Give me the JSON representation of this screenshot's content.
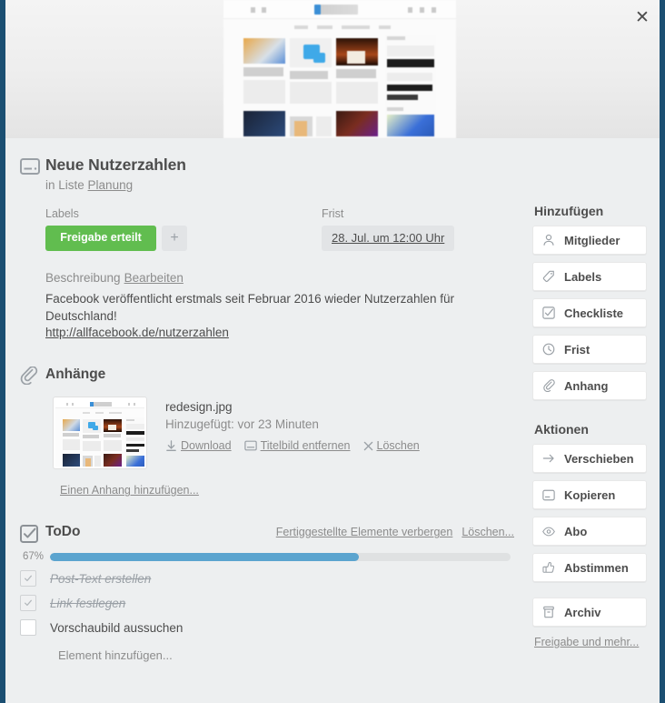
{
  "window": {
    "close_label": "✕"
  },
  "card": {
    "icon": "card-icon",
    "title": "Neue Nutzerzahlen",
    "in_list_prefix": "in Liste",
    "list_name": "Planung"
  },
  "labels": {
    "heading": "Labels",
    "badge": "Freigabe erteilt",
    "badge_color": "#61bd4f",
    "add_label": "+"
  },
  "due": {
    "heading": "Frist",
    "value": "28. Jul. um 12:00 Uhr"
  },
  "description": {
    "heading": "Beschreibung",
    "edit_label": "Bearbeiten",
    "body": "Facebook veröffentlicht erstmals seit Februar 2016 wieder Nutzerzahlen für Deutschland!",
    "link": "http://allfacebook.de/nutzerzahlen"
  },
  "attachments": {
    "heading": "Anhänge",
    "items": [
      {
        "filename": "redesign.jpg",
        "added": "Hinzugefügt: vor 23 Minuten",
        "actions": [
          {
            "icon": "download-icon",
            "label": "Download"
          },
          {
            "icon": "cover-image-icon",
            "label": "Titelbild entfernen"
          },
          {
            "icon": "close-icon",
            "label": "Löschen"
          }
        ]
      }
    ],
    "add_link": "Einen Anhang hinzufügen..."
  },
  "checklist": {
    "heading": "ToDo",
    "hide_completed_label": "Fertiggestellte Elemente verbergen",
    "delete_label": "Löschen...",
    "progress_pct_text": "67%",
    "progress_pct": 67,
    "progress_color": "#5ba4cf",
    "items": [
      {
        "text": "Post-Text erstellen",
        "checked": true
      },
      {
        "text": "Link festlegen",
        "checked": true
      },
      {
        "text": "Vorschaubild aussuchen",
        "checked": false
      }
    ],
    "add_item_label": "Element hinzufügen..."
  },
  "sidebar": {
    "add_heading": "Hinzufügen",
    "add_items": [
      {
        "icon": "member-icon",
        "label": "Mitglieder"
      },
      {
        "icon": "label-icon",
        "label": "Labels"
      },
      {
        "icon": "checklist-icon",
        "label": "Checkliste"
      },
      {
        "icon": "clock-icon",
        "label": "Frist"
      },
      {
        "icon": "attachment-icon",
        "label": "Anhang"
      }
    ],
    "actions_heading": "Aktionen",
    "action_items": [
      {
        "icon": "arrow-right-icon",
        "label": "Verschieben"
      },
      {
        "icon": "card-icon",
        "label": "Kopieren"
      },
      {
        "icon": "eye-icon",
        "label": "Abo"
      },
      {
        "icon": "thumbs-up-icon",
        "label": "Abstimmen"
      }
    ],
    "archive_item": {
      "icon": "archive-icon",
      "label": "Archiv"
    },
    "more_link": "Freigabe und mehr..."
  }
}
